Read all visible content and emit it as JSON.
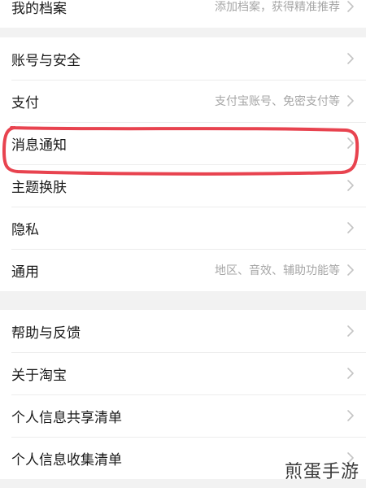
{
  "groups": [
    {
      "items": [
        {
          "label": "我的档案",
          "hint": "添加档案，获得精准推荐"
        }
      ]
    },
    {
      "items": [
        {
          "label": "账号与安全",
          "hint": ""
        },
        {
          "label": "支付",
          "hint": "支付宝账号、免密支付等"
        },
        {
          "label": "消息通知",
          "hint": ""
        },
        {
          "label": "主题换肤",
          "hint": ""
        },
        {
          "label": "隐私",
          "hint": ""
        },
        {
          "label": "通用",
          "hint": "地区、音效、辅助功能等"
        }
      ]
    },
    {
      "items": [
        {
          "label": "帮助与反馈",
          "hint": ""
        },
        {
          "label": "关于淘宝",
          "hint": ""
        },
        {
          "label": "个人信息共享清单",
          "hint": ""
        },
        {
          "label": "个人信息收集清单",
          "hint": ""
        }
      ]
    }
  ],
  "icons": {
    "row_arrow": "chevron-right-icon"
  },
  "colors": {
    "background": "#f2f2f2",
    "row_bg": "#ffffff",
    "label": "#1a1a1a",
    "hint": "#a6a6a6",
    "highlight": "#e8434f"
  },
  "watermark": "煎蛋手游"
}
